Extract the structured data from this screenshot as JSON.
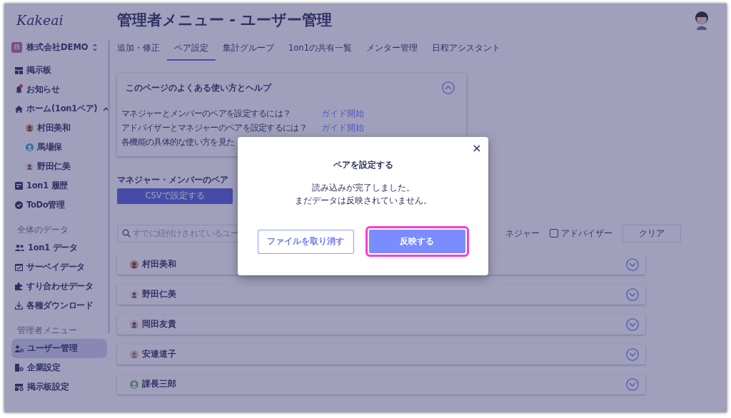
{
  "sidebar": {
    "logo": "Kakeai",
    "company": {
      "badge": "株",
      "name": "株式会社DEMO"
    },
    "groups": [
      {
        "items": [
          {
            "label": "掲示板",
            "selected": false
          },
          {
            "label": "お知らせ",
            "selected": false,
            "unread": true
          },
          {
            "label": "ホーム(1on1ペア)",
            "selected": false,
            "expanded": true,
            "children": [
              {
                "label": "村田美和",
                "selected": false
              },
              {
                "label": "馬場保",
                "selected": false
              },
              {
                "label": "野田仁美",
                "selected": false
              }
            ]
          },
          {
            "label": "1on1 履歴",
            "selected": false
          },
          {
            "label": "ToDo管理",
            "selected": false
          }
        ]
      },
      {
        "heading": "全体のデータ",
        "items": [
          {
            "label": "1on1 データ",
            "selected": false
          },
          {
            "label": "サーベイデータ",
            "selected": false
          },
          {
            "label": "すり合わせデータ",
            "selected": false
          },
          {
            "label": "各種ダウンロード",
            "selected": false
          }
        ]
      },
      {
        "heading": "管理者メニュー",
        "items": [
          {
            "label": "ユーザー管理",
            "selected": true
          },
          {
            "label": "企業設定",
            "selected": false
          },
          {
            "label": "掲示板設定",
            "selected": false
          }
        ]
      }
    ]
  },
  "page": {
    "title": "管理者メニュー - ユーザー管理",
    "tabs": [
      {
        "label": "追加・修正",
        "selected": false
      },
      {
        "label": "ペア設定",
        "selected": true
      },
      {
        "label": "集計グループ",
        "selected": false
      },
      {
        "label": "1on1の共有一覧",
        "selected": false
      },
      {
        "label": "メンター管理",
        "selected": false
      },
      {
        "label": "日程アシスタント",
        "selected": false
      }
    ],
    "help": {
      "title": "このページのよくある使い方とヘルプ",
      "expanded": true,
      "rows": [
        {
          "question": "マネジャーとメンバーのペアを設定するには？",
          "link": "ガイド開始"
        },
        {
          "question": "アドバイザーとマネジャーのペアを設定するには？",
          "link": "ガイド開始"
        },
        {
          "question": "各機能の具体的な使い方を見た"
        }
      ]
    },
    "section_title": "マネジャー・メンバーのペア",
    "csv_button": "CSVで設定する",
    "search": {
      "placeholder": "すでに紐付けされているユー"
    },
    "filters": [
      {
        "kind": "label",
        "label": "ネジャー"
      },
      {
        "kind": "checkbox",
        "label": "アドバイザー",
        "checked": false
      }
    ],
    "clear_button": "クリア",
    "pairs": [
      {
        "name": "村田美和",
        "expanded": false
      },
      {
        "name": "野田仁美",
        "expanded": false
      },
      {
        "name": "岡田友貴",
        "expanded": false
      },
      {
        "name": "安達道子",
        "expanded": false
      },
      {
        "name": "課長三郎",
        "expanded": false
      }
    ]
  },
  "dialog": {
    "title": "ペアを設定する",
    "message": [
      "読み込みが完了しました。",
      "まだデータは反映されていません。"
    ],
    "cancel_button": "ファイルを取り消す",
    "confirm_button": "反映する",
    "confirm_highlighted": true
  }
}
